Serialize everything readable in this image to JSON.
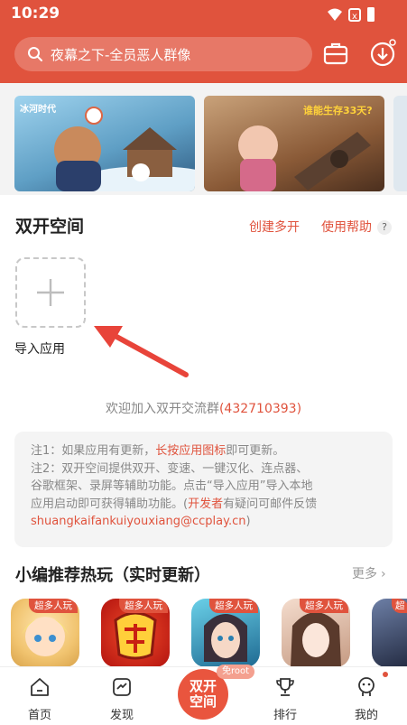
{
  "status": {
    "time": "10:29"
  },
  "search": {
    "placeholder": "夜幕之下-全员恶人群像"
  },
  "header": {
    "toolbox_icon": "briefcase-icon",
    "download_icon": "download-icon"
  },
  "banners": [
    {
      "title": "冰河时代",
      "theme": "#7ab8d8"
    },
    {
      "title": "谁能生存33天?",
      "theme": "#9e6a3a"
    }
  ],
  "dual_space": {
    "title": "双开空间",
    "create_link": "创建多开",
    "help_link": "使用帮助",
    "help_badge": "?",
    "import_label": "导入应用"
  },
  "join_group": {
    "prefix": "欢迎加入双开交流群",
    "number": "(432710393)"
  },
  "notes": {
    "line1_prefix": "注1：如果应用有更新，",
    "line1_highlight": "长按应用图标",
    "line1_suffix": "即可更新。",
    "line2": "注2：双开空间提供双开、变速、一键汉化、连点器、",
    "line3": "谷歌框架、录屏等辅助功能。点击“导入应用”导入本地",
    "line4_prefix": "应用启动即可获得辅助功能。(",
    "line4_highlight": "开发者",
    "line4_suffix": "有疑问可邮件反馈",
    "email": "shuangkaifankuiyouxiang@ccplay.cn",
    "email_suffix": ")"
  },
  "recommend": {
    "title": "小编推荐热玩（实时更新）",
    "more": "更多",
    "games": [
      {
        "tag": "超多人玩",
        "color": "#f3d38a"
      },
      {
        "tag": "超多人玩",
        "color": "#c8201c"
      },
      {
        "tag": "超多人玩",
        "color": "#2f7fa8"
      },
      {
        "tag": "超多人玩",
        "color": "#e9c6b4"
      },
      {
        "tag": "超",
        "color": "#3b4766"
      }
    ]
  },
  "bottom_nav": {
    "items": [
      {
        "label": "首页",
        "icon": "home-icon"
      },
      {
        "label": "发现",
        "icon": "discover-icon"
      },
      {
        "label": "排行",
        "icon": "trophy-icon"
      },
      {
        "label": "我的",
        "icon": "profile-icon"
      }
    ],
    "center_line1": "双开",
    "center_line2": "空间",
    "root_badge": "免root"
  },
  "colors": {
    "accent": "#e0533d",
    "background": "#ffffff",
    "panel": "#f4f4f4"
  }
}
